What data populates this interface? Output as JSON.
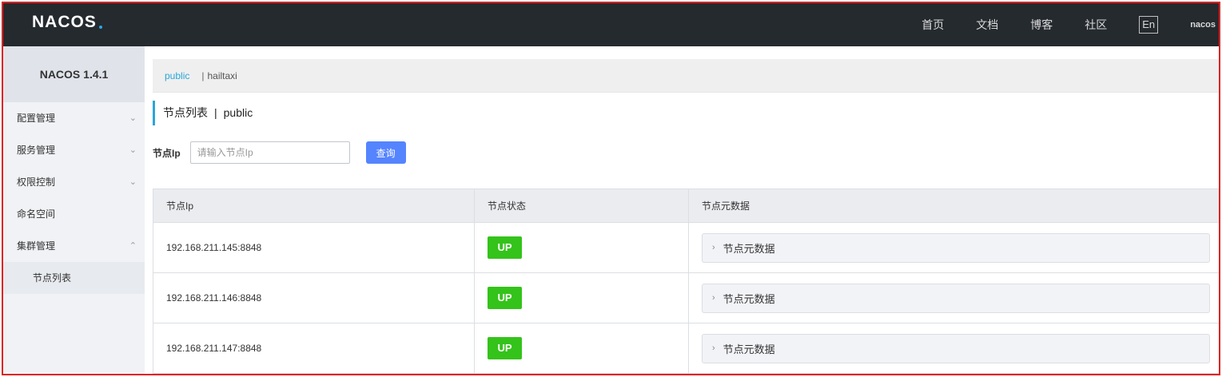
{
  "header": {
    "logo_text": "NACOS",
    "nav": [
      "首页",
      "文档",
      "博客",
      "社区"
    ],
    "lang": "En",
    "user": "nacos"
  },
  "sidebar": {
    "version": "NACOS 1.4.1",
    "items": [
      {
        "label": "配置管理",
        "chevron": "⌄"
      },
      {
        "label": "服务管理",
        "chevron": "⌄"
      },
      {
        "label": "权限控制",
        "chevron": "⌄"
      },
      {
        "label": "命名空间",
        "chevron": ""
      },
      {
        "label": "集群管理",
        "chevron": "⌃"
      }
    ],
    "subitems": [
      {
        "label": "节点列表"
      }
    ]
  },
  "namespace_bar": {
    "active": "public",
    "separator": "|",
    "other": "hailtaxi"
  },
  "page": {
    "title": "节点列表",
    "separator": "|",
    "namespace": "public"
  },
  "search": {
    "label": "节点Ip",
    "placeholder": "请输入节点Ip",
    "value": "",
    "button": "查询"
  },
  "table": {
    "headers": [
      "节点Ip",
      "节点状态",
      "节点元数据"
    ],
    "rows": [
      {
        "ip": "192.168.211.145:8848",
        "status": "UP",
        "meta": "节点元数据"
      },
      {
        "ip": "192.168.211.146:8848",
        "status": "UP",
        "meta": "节点元数据"
      },
      {
        "ip": "192.168.211.147:8848",
        "status": "UP",
        "meta": "节点元数据"
      }
    ]
  },
  "colors": {
    "topbar": "#252a2f",
    "accent": "#2aa6d8",
    "primary_button": "#5584ff",
    "status_up": "#34c31a",
    "frame_border": "#e02020"
  }
}
